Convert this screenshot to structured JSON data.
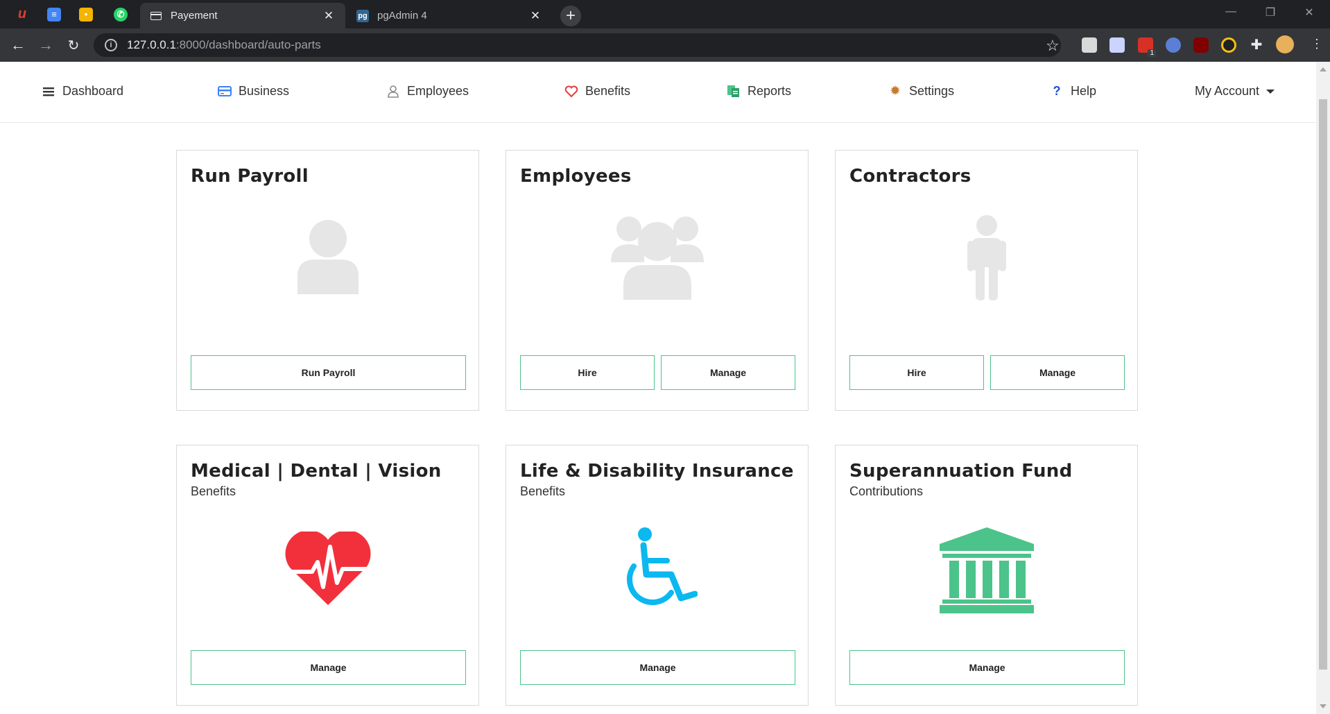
{
  "browser": {
    "pinned_tabs": [
      {
        "name": "todoist-tab",
        "glyph": "u",
        "color": "#db4035"
      },
      {
        "name": "docs-tab",
        "glyph": "≡",
        "color": "#4285f4"
      },
      {
        "name": "keep-tab",
        "glyph": "•",
        "color": "#f4b400"
      },
      {
        "name": "whatsapp-tab",
        "glyph": "✆",
        "color": "#25d366"
      }
    ],
    "tabs": [
      {
        "title": "Payement",
        "active": true
      },
      {
        "title": "pgAdmin 4",
        "active": false
      }
    ],
    "pgadmin_badge": "pg",
    "url_host": "127.0.0.1",
    "url_path": ":8000/dashboard/auto-parts",
    "extension_badge": "1",
    "colors": {
      "tabstrip": "#202124",
      "toolbar": "#35363a"
    }
  },
  "nav": {
    "dashboard": "Dashboard",
    "business": "Business",
    "employees": "Employees",
    "benefits": "Benefits",
    "reports": "Reports",
    "settings": "Settings",
    "help": "Help",
    "account": "My Account"
  },
  "cards": {
    "run_payroll": {
      "title": "Run Payroll",
      "button": "Run Payroll"
    },
    "employees": {
      "title": "Employees",
      "hire": "Hire",
      "manage": "Manage"
    },
    "contractors": {
      "title": "Contractors",
      "hire": "Hire",
      "manage": "Manage"
    },
    "medical": {
      "title": "Medical | Dental | Vision",
      "subtitle": "Benefits",
      "button": "Manage"
    },
    "life": {
      "title": "Life & Disability Insurance",
      "subtitle": "Benefits",
      "button": "Manage"
    },
    "super": {
      "title": "Superannuation Fund",
      "subtitle": "Contributions",
      "button": "Manage"
    }
  },
  "colors": {
    "button_border": "#4cc38a",
    "placeholder_icon": "#e6e6e6",
    "heart": "#f2303b",
    "wheelchair": "#0bb8f0",
    "bank": "#4cc38a"
  }
}
